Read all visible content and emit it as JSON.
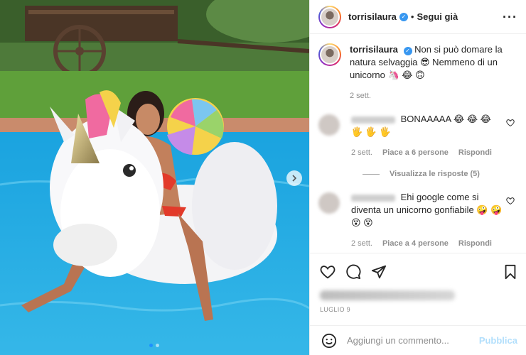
{
  "post": {
    "username": "torrisilaura",
    "follow_state": "Segui già",
    "separator": "•",
    "more_icon": "more-horizontal-icon",
    "caption": "Non si può domare la natura selvaggia 😎 Nemmeno di un unicorno 🦄 😂 🙃",
    "caption_age": "2 sett."
  },
  "comments": [
    {
      "text": "BONAAAAA 😂 😂 😂 🖐 🖐 🖐",
      "age": "2 sett.",
      "likes": "Piace a 6 persone",
      "reply": "Rispondi",
      "view_replies": "Visualizza le risposte (5)"
    },
    {
      "text": "Ehi google come si diventa un unicorno gonfiabile 🤪 🤪 😵 😵",
      "age": "2 sett.",
      "likes": "Piace a 4 persone",
      "reply": "Rispondi"
    }
  ],
  "likes_text": "Piace a",
  "date": "LUGLIO 9",
  "add_comment": {
    "placeholder": "Aggiungi un commento...",
    "publish": "Pubblica"
  },
  "carousel": {
    "slides": 2,
    "active": 1
  },
  "colors": {
    "accent": "#3897f0",
    "publish_disabled": "#b2dffc",
    "meta": "#8e8e8e"
  }
}
